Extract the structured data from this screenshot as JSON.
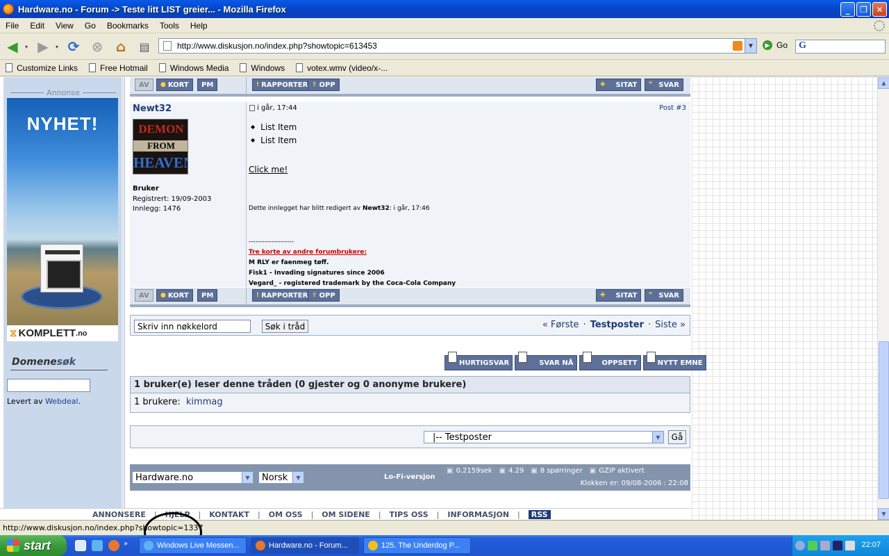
{
  "window": {
    "title": "Hardware.no - Forum -> Teste litt LIST greier... - Mozilla Firefox"
  },
  "menu": [
    "File",
    "Edit",
    "View",
    "Go",
    "Bookmarks",
    "Tools",
    "Help"
  ],
  "nav": {
    "url": "http://www.diskusjon.no/index.php?showtopic=613453",
    "go_label": "Go",
    "search_engine_glyph": "G"
  },
  "bookmarks": [
    "Customize Links",
    "Free Hotmail",
    "Windows Media",
    "Windows",
    "votex.wmv (video/x-..."
  ],
  "sidebar": {
    "annonse_label": "Annonse",
    "ad_headline": "NYHET!",
    "ad_brand": "KOMPLETT",
    "ad_brand_suffix": ".no",
    "domene_a": "Domene",
    "domene_b": "søk",
    "levert_prefix": "Levert av",
    "levert_link": "Webdeal",
    "levert_suffix": "."
  },
  "buttons": {
    "av": "AV",
    "kort": "KORT",
    "pm": "PM",
    "rapporter": "RAPPORTER",
    "opp": "OPP",
    "sitat": "SITAT",
    "svar": "SVAR"
  },
  "post": {
    "author": "Newt32",
    "date": "i går, 17:44",
    "number": "Post #3",
    "avatar_lines": [
      "DEMON",
      "FROM",
      "HEAVEN"
    ],
    "group": "Bruker",
    "registered": "Registrert: 19/09-2003",
    "posts": "Innlegg: 1476",
    "list_items": [
      "List Item",
      "List Item"
    ],
    "link_text": "Click me!",
    "edited_prefix": "Dette innlegget har blitt redigert av",
    "edited_by": "Newt32",
    "edited_time": ": i går, 17:46",
    "signature": {
      "dashes": "--------------------",
      "heading": "Tre korte av andre forumbrukere:",
      "lines": [
        "M RLY er faenmeg tøff.",
        "Fisk1 - Invading signatures since 2006",
        "Vegard_ - registered trademark by the Coca-Cola Company"
      ]
    }
  },
  "thread_search": {
    "value": "Skriv inn nøkkelord",
    "button": "Søk i tråd"
  },
  "pager": {
    "first": "« Første",
    "sep": "·",
    "current": "Testposter",
    "last": "Siste »"
  },
  "actions": [
    "HURTIGSVAR",
    "SVAR NÅ",
    "OPPSETT",
    "NYTT EMNE"
  ],
  "readers": {
    "header": "1 bruker(e) leser denne tråden (0 gjester og 0 anonyme brukere)",
    "label": "1 brukere:",
    "user": "kimmag"
  },
  "jump": {
    "selected": "|-- Testposter",
    "go": "Gå"
  },
  "footer": {
    "skin": "Hardware.no",
    "language": "Norsk",
    "lofi": "Lo-Fi-versjon",
    "time": "0.2159sek",
    "load": "4.29",
    "queries": "8 spørringer",
    "gzip": "GZIP aktivert",
    "clock": "Klokken er: 09/08-2006 : 22:08"
  },
  "bottom_links": [
    "ANNONSERE",
    "HJELP",
    "KONTAKT",
    "OM OSS",
    "OM SIDENE",
    "TIPS OSS",
    "INFORMASJON"
  ],
  "bottom_rss": "RSS",
  "status": "http://www.diskusjon.no/index.php?showtopic=1337",
  "taskbar": {
    "start": "start",
    "tasks": [
      "Windows Live Messen...",
      "Hardware.no - Forum...",
      "125. The Underdog P..."
    ],
    "clock": "22:07"
  }
}
